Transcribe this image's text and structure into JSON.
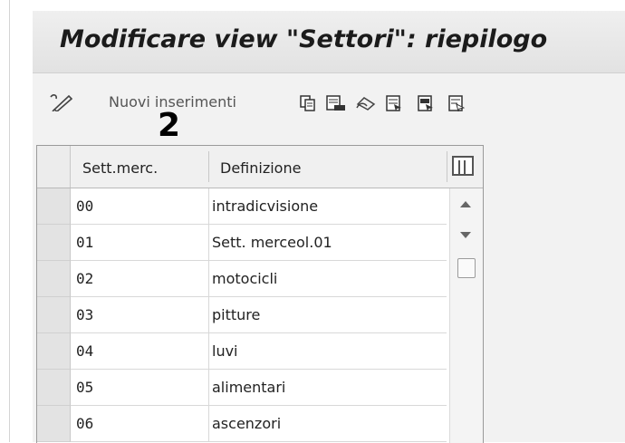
{
  "window": {
    "title": "Modificare view \"Settori\": riepilogo"
  },
  "toolbar": {
    "new_entries_label": "Nuovi inserimenti",
    "icons": [
      "change-display-icon",
      "copy-icon",
      "delete-icon",
      "undo-icon",
      "select-all-icon",
      "select-block-icon",
      "deselect-all-icon"
    ]
  },
  "annotation": {
    "marker": "2"
  },
  "table": {
    "columns": [
      "Sett.merc.",
      "Definizione"
    ],
    "rows": [
      {
        "code": "00",
        "definition": "intradicvisione"
      },
      {
        "code": "01",
        "definition": "Sett. merceol.01"
      },
      {
        "code": "02",
        "definition": "motocicli"
      },
      {
        "code": "03",
        "definition": "pitture"
      },
      {
        "code": "04",
        "definition": "luvi"
      },
      {
        "code": "05",
        "definition": "alimentari"
      },
      {
        "code": "06",
        "definition": "ascenzori"
      }
    ]
  },
  "colors": {
    "background": "#f2f2f2",
    "selector_cell": "#e3e3e3"
  }
}
